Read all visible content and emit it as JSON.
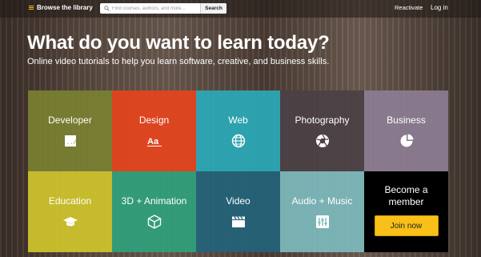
{
  "topbar": {
    "browse_label": "Browse the library",
    "search_placeholder": "Find courses, authors, and more...",
    "search_button": "Search",
    "reactivate_label": "Reactivate",
    "login_label": "Log in"
  },
  "hero": {
    "title": "What do you want to learn today?",
    "subtitle": "Online video tutorials to help you learn software, creative, and business skills."
  },
  "categories": [
    {
      "label": "Developer",
      "icon": "terminal-icon",
      "color": "#7a8231"
    },
    {
      "label": "Design",
      "icon": "typography-icon",
      "color": "#e2451f"
    },
    {
      "label": "Web",
      "icon": "globe-icon",
      "color": "#2aa9b7"
    },
    {
      "label": "Photography",
      "icon": "aperture-icon",
      "color": "#5b4e52"
    },
    {
      "label": "Business",
      "icon": "pie-chart-icon",
      "color": "#8d7d93"
    },
    {
      "label": "Education",
      "icon": "graduation-cap-icon",
      "color": "#cfc62b"
    },
    {
      "label": "3D + Animation",
      "icon": "cube-icon",
      "color": "#2fa17b"
    },
    {
      "label": "Video",
      "icon": "clapperboard-icon",
      "color": "#23637a"
    },
    {
      "label": "Audio + Music",
      "icon": "equalizer-icon",
      "color": "#7dbabd"
    }
  ],
  "member": {
    "label": "Become a member",
    "button": "Join now",
    "color": "#000000",
    "button_color": "#f8c018"
  }
}
